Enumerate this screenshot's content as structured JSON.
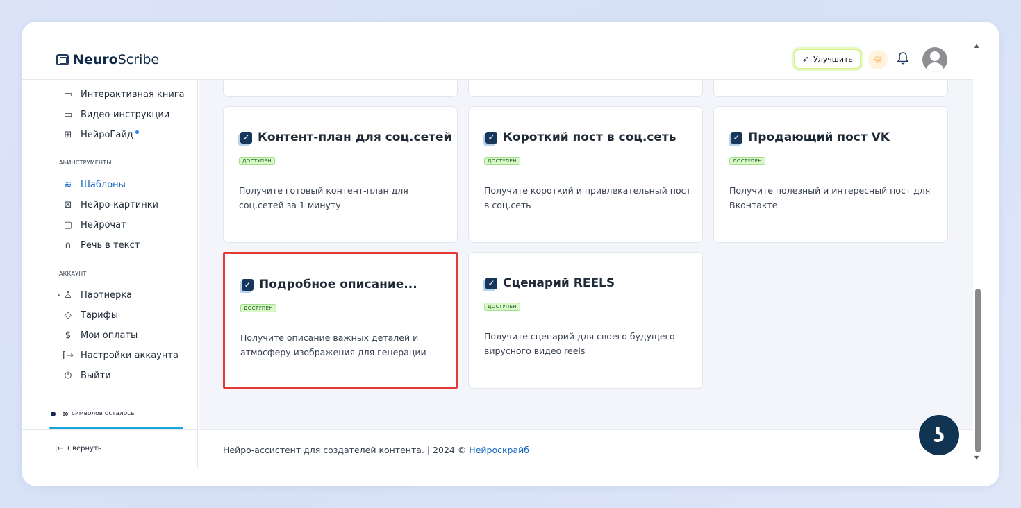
{
  "app": {
    "brand_bold": "Neuro",
    "brand_light": "Scribe",
    "upgrade_label": "Улучшить"
  },
  "sidebar": {
    "items_top": [
      {
        "label": "Интерактивная книга",
        "icon": "book-icon"
      },
      {
        "label": "Видео-инструкции",
        "icon": "video-icon"
      },
      {
        "label": "НейроГайд",
        "icon": "guide-icon"
      }
    ],
    "section_ai": "AI-ИНСТРУМЕНТЫ",
    "items_ai": [
      {
        "label": "Шаблоны",
        "icon": "layers-icon",
        "active": true
      },
      {
        "label": "Нейро-картинки",
        "icon": "image-icon"
      },
      {
        "label": "Нейрочат",
        "icon": "chat-icon"
      },
      {
        "label": "Речь в текст",
        "icon": "headphones-icon"
      }
    ],
    "section_account": "АККАУНТ",
    "items_account": [
      {
        "label": "Партнерка",
        "icon": "users-icon"
      },
      {
        "label": "Тарифы",
        "icon": "tag-icon"
      },
      {
        "label": "Мои оплаты",
        "icon": "dollar-icon"
      },
      {
        "label": "Настройки аккаунта",
        "icon": "settings-icon"
      },
      {
        "label": "Выйти",
        "icon": "power-icon"
      }
    ],
    "symbols_label": "символов осталось",
    "symbols_value": "∞",
    "collapse_label": "Свернуть"
  },
  "cards": [
    {
      "title": "Контент-план для соц.сетей",
      "badge": "ДОСТУПЕН",
      "desc": "Получите готовый контент-план для соц.сетей за 1 минуту"
    },
    {
      "title": "Короткий пост в соц.сеть",
      "badge": "ДОСТУПЕН",
      "desc": "Получите короткий и привлекательный пост в соц.сеть"
    },
    {
      "title": "Продающий пост VK",
      "badge": "ДОСТУПЕН",
      "desc": "Получите полезный и интересный пост для Вконтакте"
    },
    {
      "title": "Подробное описание...",
      "badge": "ДОСТУПЕН",
      "desc": "Получите описание важных деталей и атмосферу изображения для генерации"
    },
    {
      "title": "Сценарий REELS",
      "badge": "ДОСТУПЕН",
      "desc": "Получите сценарий для своего будущего вирусного видео reels"
    }
  ],
  "footer": {
    "text": "Нейро-ассистент для создателей контента.  | 2024 © ",
    "link": "Нейроскрайб"
  },
  "colors": {
    "accent": "#1565c0",
    "navy": "#113453",
    "badge_bg": "#d9f7c9",
    "highlight": "#e53935"
  }
}
